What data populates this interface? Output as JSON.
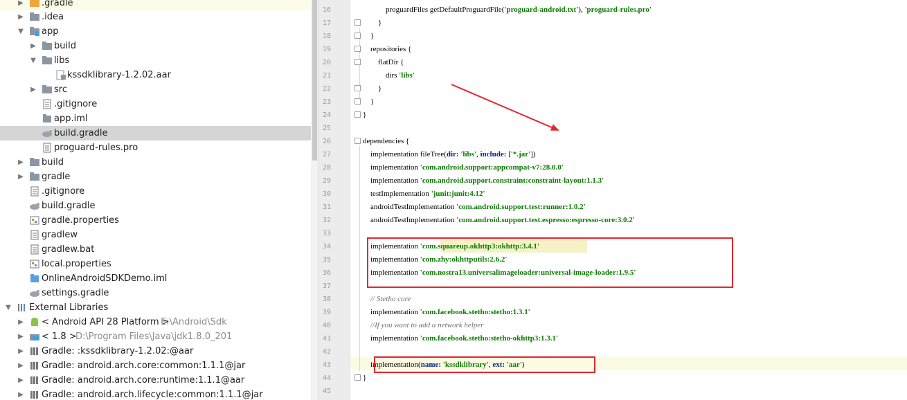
{
  "tree": {
    "items": [
      {
        "label": ".gradle",
        "icon": "orange-folder-icon"
      },
      {
        "label": ".idea",
        "icon": "folder-icon"
      },
      {
        "label": "app",
        "icon": "module-folder-icon"
      },
      {
        "label": "build",
        "icon": "folder-icon"
      },
      {
        "label": "libs",
        "icon": "folder-icon"
      },
      {
        "label": "kssdklibrary-1.2.02.aar",
        "icon": "archive-file-icon"
      },
      {
        "label": "src",
        "icon": "folder-icon"
      },
      {
        "label": ".gitignore",
        "icon": "text-file-icon"
      },
      {
        "label": "app.iml",
        "icon": "iml-file-icon"
      },
      {
        "label": "build.gradle",
        "icon": "gradle-file-icon"
      },
      {
        "label": "proguard-rules.pro",
        "icon": "text-file-icon"
      },
      {
        "label": "build",
        "icon": "folder-icon"
      },
      {
        "label": "gradle",
        "icon": "folder-icon"
      },
      {
        "label": ".gitignore",
        "icon": "text-file-icon"
      },
      {
        "label": "build.gradle",
        "icon": "gradle-file-icon"
      },
      {
        "label": "gradle.properties",
        "icon": "properties-file-icon"
      },
      {
        "label": "gradlew",
        "icon": "text-file-icon"
      },
      {
        "label": "gradlew.bat",
        "icon": "text-file-icon"
      },
      {
        "label": "local.properties",
        "icon": "properties-file-icon"
      },
      {
        "label": "OnlineAndroidSDKDemo.iml",
        "icon": "iml-file-icon"
      },
      {
        "label": "settings.gradle",
        "icon": "gradle-file-icon"
      },
      {
        "label": "External Libraries",
        "icon": "libraries-icon"
      },
      {
        "label": "< Android API 28 Platform >",
        "hint": "E:\\Android\\Sdk",
        "icon": "android-icon"
      },
      {
        "label": "< 1.8 >",
        "hint": "D:\\Program Files\\Java\\jdk1.8.0_201",
        "icon": "jdk-icon"
      },
      {
        "label": "Gradle: :kssdklibrary-1.2.02:@aar",
        "icon": "library-icon"
      },
      {
        "label": "Gradle: android.arch.core:common:1.1.1@jar",
        "icon": "library-icon"
      },
      {
        "label": "Gradle: android.arch.core:runtime:1.1.1@aar",
        "icon": "library-icon"
      },
      {
        "label": "Gradle: android.arch.lifecycle:common:1.1.1@jar",
        "icon": "library-icon"
      }
    ]
  },
  "editor": {
    "lines": [
      {
        "n": "16",
        "t": [
          [
            "            proguardFiles getDefaultProguardFile(",
            ""
          ],
          [
            "'proguard-android.txt'",
            "s"
          ],
          [
            "), ",
            ""
          ],
          [
            "'proguard-rules.pro'",
            "s"
          ]
        ]
      },
      {
        "n": "17",
        "t": [
          [
            "        }",
            ""
          ]
        ]
      },
      {
        "n": "18",
        "t": [
          [
            "    }",
            ""
          ]
        ]
      },
      {
        "n": "19",
        "t": [
          [
            "    repositories {",
            ""
          ]
        ]
      },
      {
        "n": "20",
        "t": [
          [
            "        flatDir {",
            ""
          ]
        ]
      },
      {
        "n": "21",
        "t": [
          [
            "            dirs ",
            ""
          ],
          [
            "'libs'",
            "s"
          ]
        ]
      },
      {
        "n": "22",
        "t": [
          [
            "        }",
            ""
          ]
        ]
      },
      {
        "n": "23",
        "t": [
          [
            "    }",
            ""
          ]
        ]
      },
      {
        "n": "24",
        "t": [
          [
            "}",
            ""
          ]
        ]
      },
      {
        "n": "25",
        "t": []
      },
      {
        "n": "26",
        "t": [
          [
            "dependencies {",
            ""
          ]
        ]
      },
      {
        "n": "27",
        "t": [
          [
            "    implementation fileTree(",
            ""
          ],
          [
            "dir: ",
            "k"
          ],
          [
            "'libs'",
            "s"
          ],
          [
            ", ",
            ""
          ],
          [
            "include: ",
            "k"
          ],
          [
            "['*.jar'",
            "s"
          ],
          [
            "])",
            ""
          ]
        ]
      },
      {
        "n": "28",
        "t": [
          [
            "    implementation ",
            ""
          ],
          [
            "'com.android.support:appcompat-v7:28.0.0'",
            "s"
          ]
        ]
      },
      {
        "n": "29",
        "t": [
          [
            "    implementation ",
            ""
          ],
          [
            "'com.android.support.constraint:constraint-layout:1.1.3'",
            "s"
          ]
        ]
      },
      {
        "n": "30",
        "t": [
          [
            "    testImplementation ",
            ""
          ],
          [
            "'junit:junit:4.12'",
            "s"
          ]
        ]
      },
      {
        "n": "31",
        "t": [
          [
            "    androidTestImplementation ",
            ""
          ],
          [
            "'com.android.support.test:runner:1.0.2'",
            "s"
          ]
        ]
      },
      {
        "n": "32",
        "t": [
          [
            "    androidTestImplementation ",
            ""
          ],
          [
            "'com.android.support.test.espresso:espresso-core:3.0.2'",
            "s"
          ]
        ]
      },
      {
        "n": "33",
        "t": []
      },
      {
        "n": "34",
        "t": [
          [
            "    implementation ",
            ""
          ],
          [
            "'com.squareup.okhttp3:okhttp:3.4.1'",
            "s"
          ]
        ]
      },
      {
        "n": "35",
        "t": [
          [
            "    implementation ",
            ""
          ],
          [
            "'com.zhy:okhttputils:2.6.2'",
            "s"
          ]
        ]
      },
      {
        "n": "36",
        "t": [
          [
            "    implementation ",
            ""
          ],
          [
            "'com.nostra13.universalimageloader:universal-image-loader:1.9.5'",
            "s"
          ]
        ]
      },
      {
        "n": "37",
        "t": []
      },
      {
        "n": "38",
        "t": [
          [
            "    // Stetho core",
            "c"
          ]
        ]
      },
      {
        "n": "39",
        "t": [
          [
            "    implementation ",
            ""
          ],
          [
            "'com.facebook.stetho:stetho:1.3.1'",
            "s"
          ]
        ]
      },
      {
        "n": "40",
        "t": [
          [
            "    //If you want to add a network helper",
            "c"
          ]
        ]
      },
      {
        "n": "41",
        "t": [
          [
            "    implementation ",
            ""
          ],
          [
            "'com.facebook.stetho:stetho-okhttp3:1.3.1'",
            "s"
          ]
        ]
      },
      {
        "n": "42",
        "t": []
      },
      {
        "n": "43",
        "t": [
          [
            "    implementation(",
            ""
          ],
          [
            "name: ",
            "k"
          ],
          [
            "'kssdklibrary'",
            "s"
          ],
          [
            ", ",
            ""
          ],
          [
            "ext: ",
            "k"
          ],
          [
            "'aar'",
            "s"
          ],
          [
            ")",
            ""
          ]
        ]
      },
      {
        "n": "44",
        "t": [
          [
            "}",
            ""
          ]
        ]
      },
      {
        "n": "45",
        "t": []
      }
    ]
  },
  "colors": {
    "annotation": "#e3262b",
    "string": "#0b7a00",
    "keyword": "#001f8c",
    "comment": "#707070"
  }
}
